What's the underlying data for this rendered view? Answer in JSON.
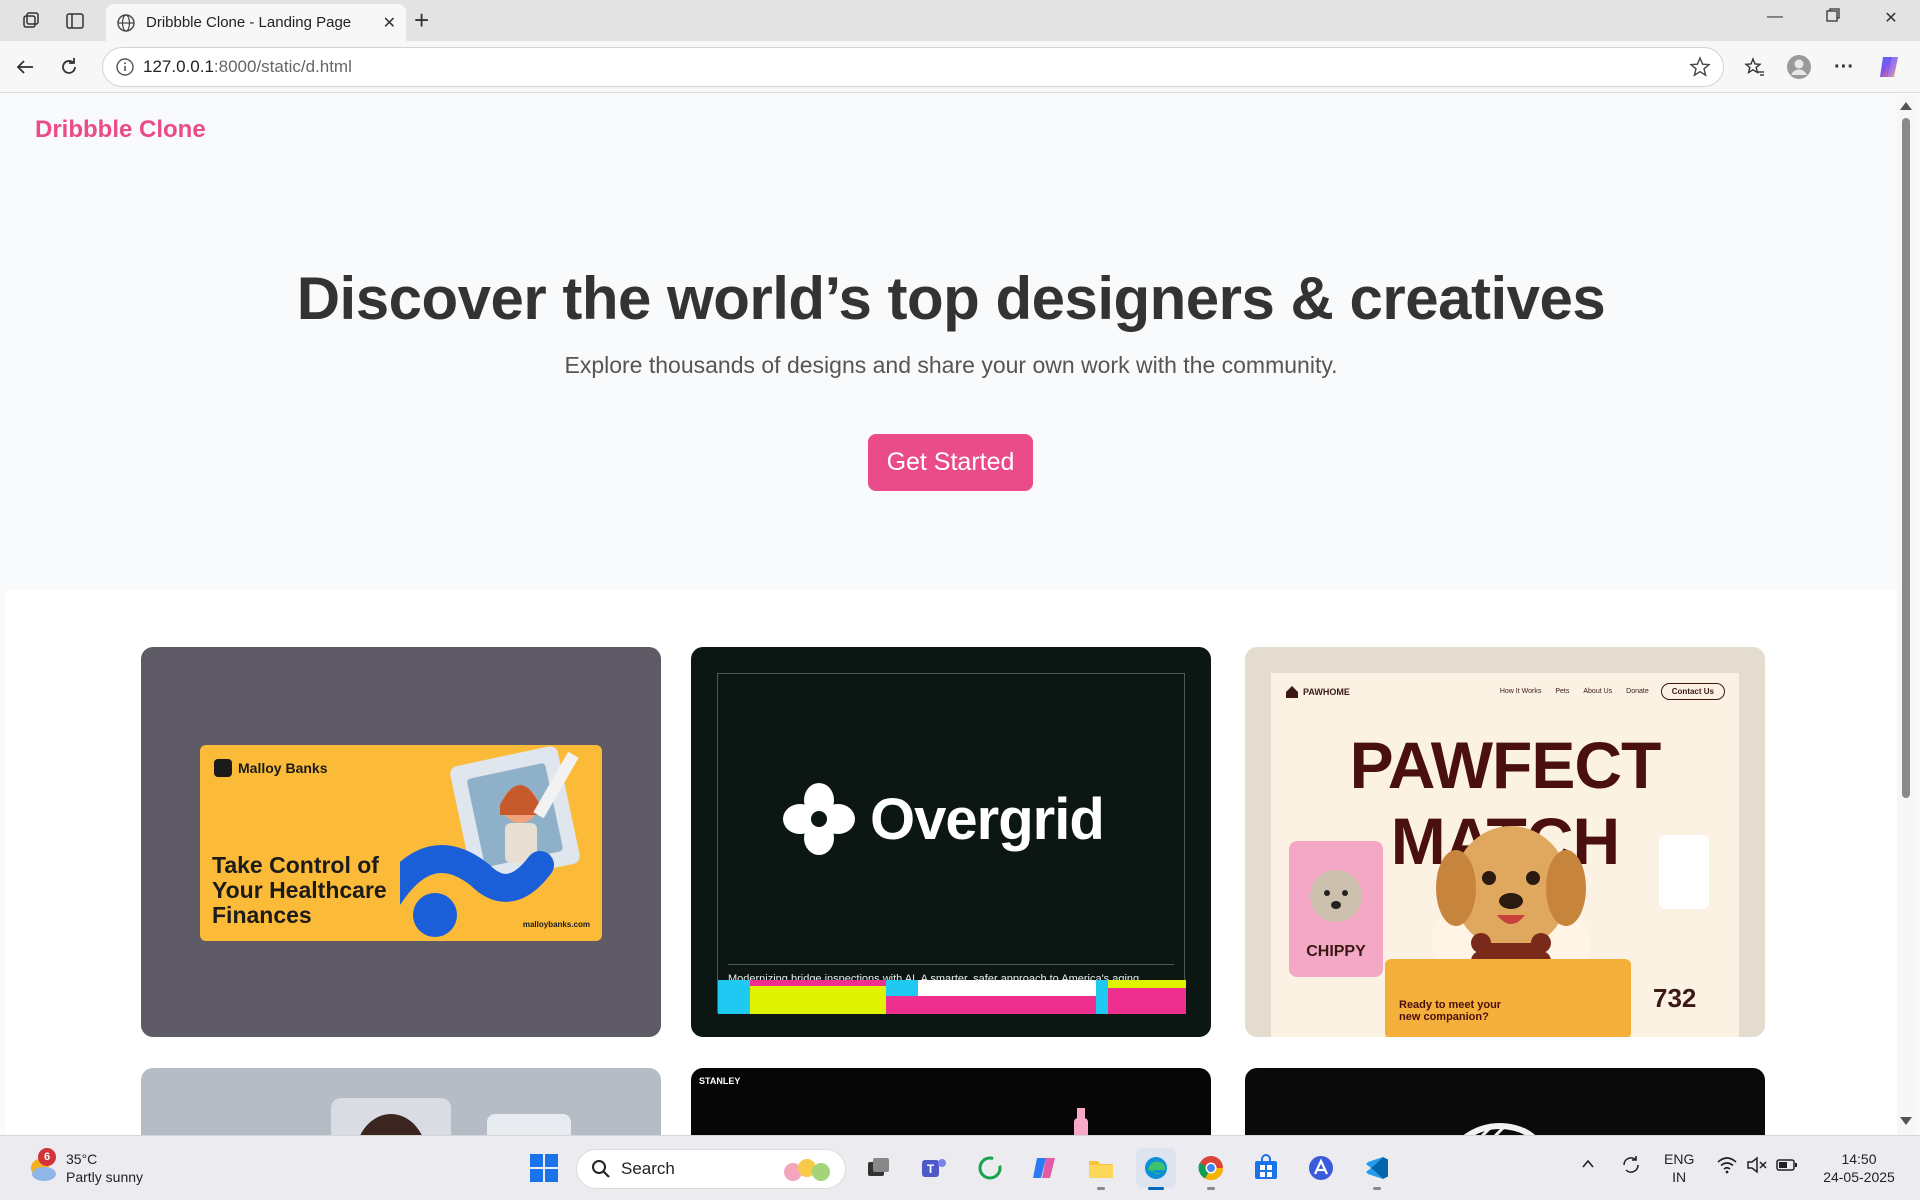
{
  "browser": {
    "tab_title": "Dribbble Clone - Landing Page",
    "url_host": "127.0.0.1",
    "url_path": ":8000/static/d.html"
  },
  "page": {
    "brand": "Dribbble Clone",
    "hero_title": "Discover the world’s top designers & creatives",
    "hero_subtitle": "Explore thousands of designs and share your own work with the community.",
    "cta_label": "Get Started",
    "accent_color": "#ea4c89"
  },
  "shots": {
    "card1": {
      "logo": "Malloy Banks",
      "headline": "Take Control of Your Healthcare Finances",
      "url": "malloybanks.com"
    },
    "card2": {
      "wordmark": "Overgrid",
      "caption": "Modernizing bridge inspections with AI. A smarter, safer approach to America's aging infrastructure."
    },
    "card3": {
      "logo": "PAWHOME",
      "nav_items": [
        "How It Works",
        "Pets",
        "About Us",
        "Donate"
      ],
      "contact": "Contact Us",
      "title": "PAWFECT MATCH",
      "pet_name": "CHIPPY",
      "question": "Ready to meet your new companion?",
      "count": "732"
    },
    "card5": {
      "logo": "STANLEY"
    }
  },
  "taskbar": {
    "weather_temp": "35°C",
    "weather_desc": "Partly sunny",
    "weather_badge": "6",
    "search_placeholder": "Search",
    "lang_top": "ENG",
    "lang_bottom": "IN",
    "time": "14:50",
    "date": "24-05-2025"
  }
}
